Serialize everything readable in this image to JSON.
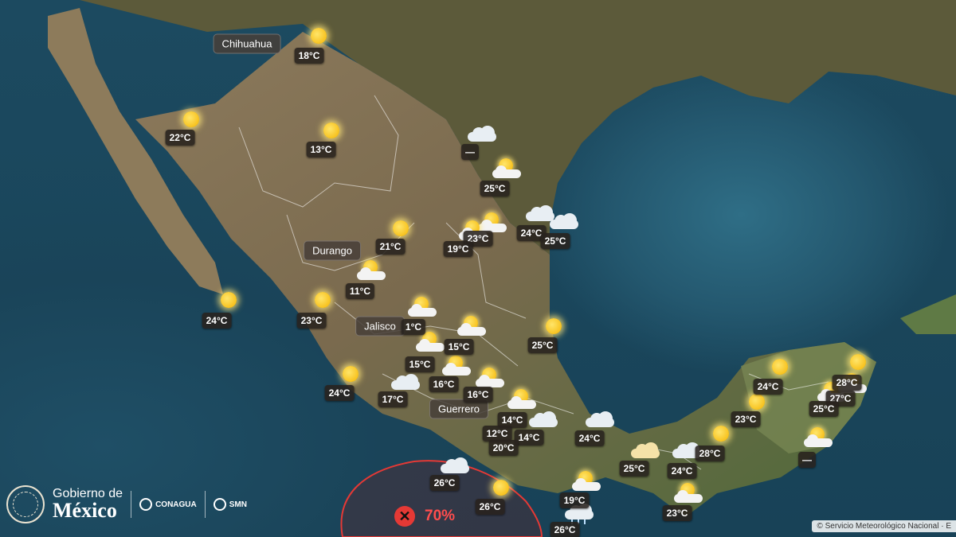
{
  "branding": {
    "gov_line1": "Gobierno de",
    "gov_line2": "México",
    "org1": "CONAGUA",
    "org2": "SMN"
  },
  "copyright": "© Servicio Meteorológico Nacional · E",
  "risk": {
    "probability": "70%"
  },
  "states": {
    "chihuahua": "Chihuahua",
    "durango": "Durango",
    "jalisco": "Jalisco",
    "guerrero": "Guerrero"
  },
  "temps": {
    "t01": "18°C",
    "t02": "22°C",
    "t03": "13°C",
    "t04": "—",
    "t05": "25°C",
    "t06": "21°C",
    "t07": "23°C",
    "t08": "19°C",
    "t09": "24°C",
    "t10": "25°C",
    "t11": "11°C",
    "t12": "24°C",
    "t13": "23°C",
    "t14": "1°C",
    "t15": "15°C",
    "t16": "15°C",
    "t17": "25°C",
    "t18": "24°C",
    "t19": "16°C",
    "t20": "17°C",
    "t21": "16°C",
    "t22": "14°C",
    "t23": "12°C",
    "t24": "14°C",
    "t25": "20°C",
    "t26": "24°C",
    "t27": "28°C",
    "t28": "27°C",
    "t29": "23°C",
    "t30": "25°C",
    "t31": "26°C",
    "t32": "26°C",
    "t33": "28°C",
    "t34": "25°C",
    "t35": "24°C",
    "t36": "19°C",
    "t37": "23°C",
    "t38": "—",
    "t39": "26°C",
    "t40": "24°C"
  }
}
